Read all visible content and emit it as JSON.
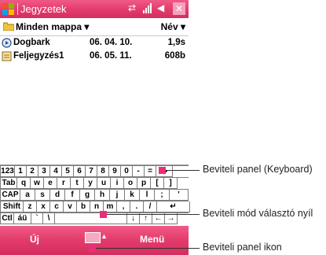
{
  "titlebar": {
    "title": "Jegyzetek"
  },
  "folderbar": {
    "folder": "Minden mappa ▾",
    "sort": "Név ▾"
  },
  "files": [
    {
      "name": "Dogbark",
      "date": "06. 04. 10.",
      "size": "1,9s",
      "icon": "recording-icon"
    },
    {
      "name": "Feljegyzés1",
      "date": "06. 05. 11.",
      "size": "608b",
      "icon": "note-icon"
    }
  ],
  "keyboard": {
    "row1": [
      "123",
      "1",
      "2",
      "3",
      "4",
      "5",
      "6",
      "7",
      "8",
      "9",
      "0",
      "-",
      "=",
      "◆"
    ],
    "row2": [
      "Tab",
      "q",
      "w",
      "e",
      "r",
      "t",
      "y",
      "u",
      "i",
      "o",
      "p",
      "[",
      "]"
    ],
    "row3": [
      "CAP",
      "a",
      "s",
      "d",
      "f",
      "g",
      "h",
      "j",
      "k",
      "l",
      ";",
      "'"
    ],
    "row4": [
      "Shift",
      "z",
      "x",
      "c",
      "v",
      "b",
      "n",
      "m",
      ",",
      ".",
      "/",
      "↵"
    ],
    "row5": [
      "Ctl",
      "áü",
      "`",
      "\\",
      "",
      "↓",
      "↑",
      "←",
      "→"
    ]
  },
  "menubar": {
    "left": "Új",
    "right": "Menü"
  },
  "callouts": {
    "keyboard": "Beviteli panel (Keyboard)",
    "selector": "Beviteli mód választó nyíl",
    "panel_icon": "Beviteli panel ikon"
  }
}
